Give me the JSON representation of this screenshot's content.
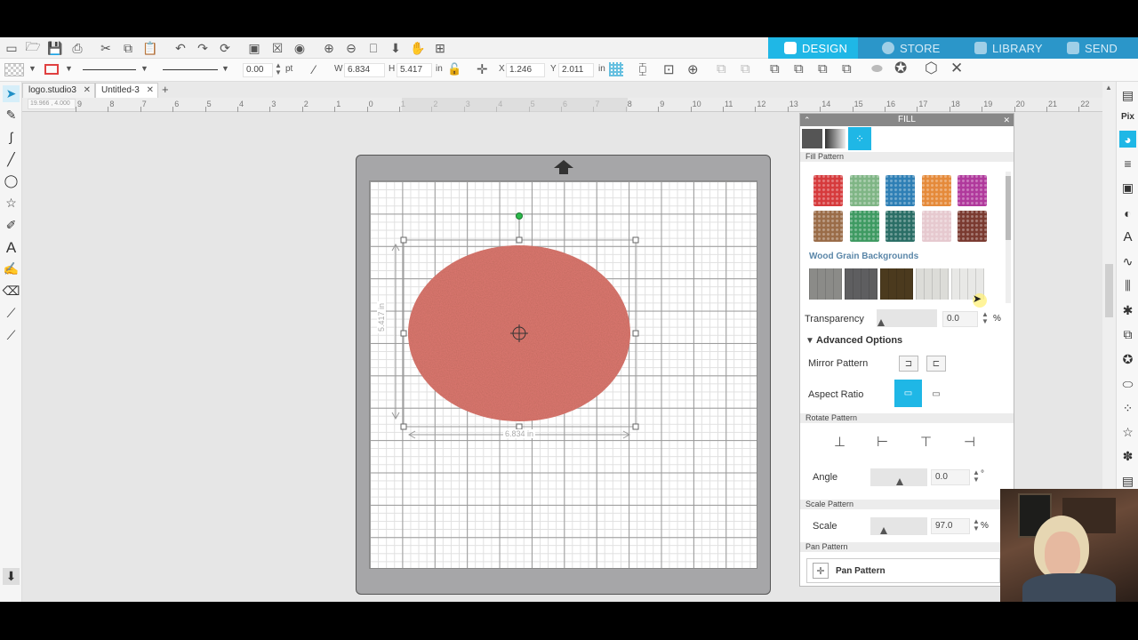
{
  "nav": {
    "tabs": [
      {
        "label": "DESIGN",
        "icon": "grid-icon",
        "active": true
      },
      {
        "label": "STORE",
        "icon": "store-icon",
        "active": false
      },
      {
        "label": "LIBRARY",
        "icon": "library-icon",
        "active": false
      },
      {
        "label": "SEND",
        "icon": "send-icon",
        "active": false
      }
    ],
    "accent": "#1fb7e6",
    "bar_color": "#2b96c9"
  },
  "toolbar2": {
    "line_width": "0.00",
    "line_unit": "pt",
    "w_label": "W",
    "w_value": "6.834",
    "h_label": "H",
    "h_value": "5.417",
    "size_unit": "in",
    "x_label": "X",
    "x_value": "1.246",
    "y_label": "Y",
    "y_value": "2.011",
    "pos_unit": "in"
  },
  "doc_tabs": [
    {
      "label": "logo.studio3",
      "active": false
    },
    {
      "label": "Untitled-3",
      "active": true
    }
  ],
  "ruler": {
    "readout": "19.966 , 4.000",
    "ticks": [
      "9",
      "8",
      "7",
      "6",
      "5",
      "4",
      "3",
      "2",
      "1",
      "0",
      "1",
      "2",
      "3",
      "4",
      "5",
      "6",
      "7",
      "8",
      "9",
      "10",
      "11",
      "12",
      "13",
      "14",
      "15",
      "16",
      "17",
      "18",
      "19",
      "20",
      "21",
      "22"
    ]
  },
  "shape": {
    "width_label": "6.834 in",
    "height_label": "5.417 in",
    "fill_color": "#d9766e"
  },
  "fill_panel": {
    "title": "FILL",
    "fill_pattern_label": "Fill Pattern",
    "glitter_swatches": [
      {
        "name": "red-glitter",
        "color": "#d63a3c"
      },
      {
        "name": "green-glitter",
        "color": "#7fb585"
      },
      {
        "name": "blue-glitter",
        "color": "#2e7fb5"
      },
      {
        "name": "orange-glitter",
        "color": "#e58a3a"
      },
      {
        "name": "magenta-glitter",
        "color": "#b0399c"
      },
      {
        "name": "brown-glitter",
        "color": "#9a6c48"
      },
      {
        "name": "emerald-glitter",
        "color": "#3e9a62"
      },
      {
        "name": "teal-glitter",
        "color": "#2a6e66"
      },
      {
        "name": "pink-glitter",
        "color": "#e6c9cf"
      },
      {
        "name": "maroon-glitter",
        "color": "#7a3a30"
      }
    ],
    "wood_heading": "Wood Grain Backgrounds",
    "wood_swatches": [
      {
        "name": "gray-wood",
        "color": "#8b8b88"
      },
      {
        "name": "slate-wood",
        "color": "#5e5e60"
      },
      {
        "name": "dark-wood",
        "color": "#4b3a1e"
      },
      {
        "name": "white-wood",
        "color": "#dcdcd8"
      },
      {
        "name": "light-wood",
        "color": "#e8e8e6"
      }
    ],
    "transparency_label": "Transparency",
    "transparency_value": "0.0",
    "transparency_unit": "%",
    "advanced_label": "Advanced Options",
    "mirror_label": "Mirror Pattern",
    "aspect_label": "Aspect Ratio",
    "rotate_section": "Rotate Pattern",
    "angle_label": "Angle",
    "angle_value": "0.0",
    "angle_unit": "°",
    "scale_section": "Scale Pattern",
    "scale_label": "Scale",
    "scale_value": "97.0",
    "scale_unit": "%",
    "pan_section": "Pan Pattern",
    "pan_button": "Pan Pattern"
  }
}
